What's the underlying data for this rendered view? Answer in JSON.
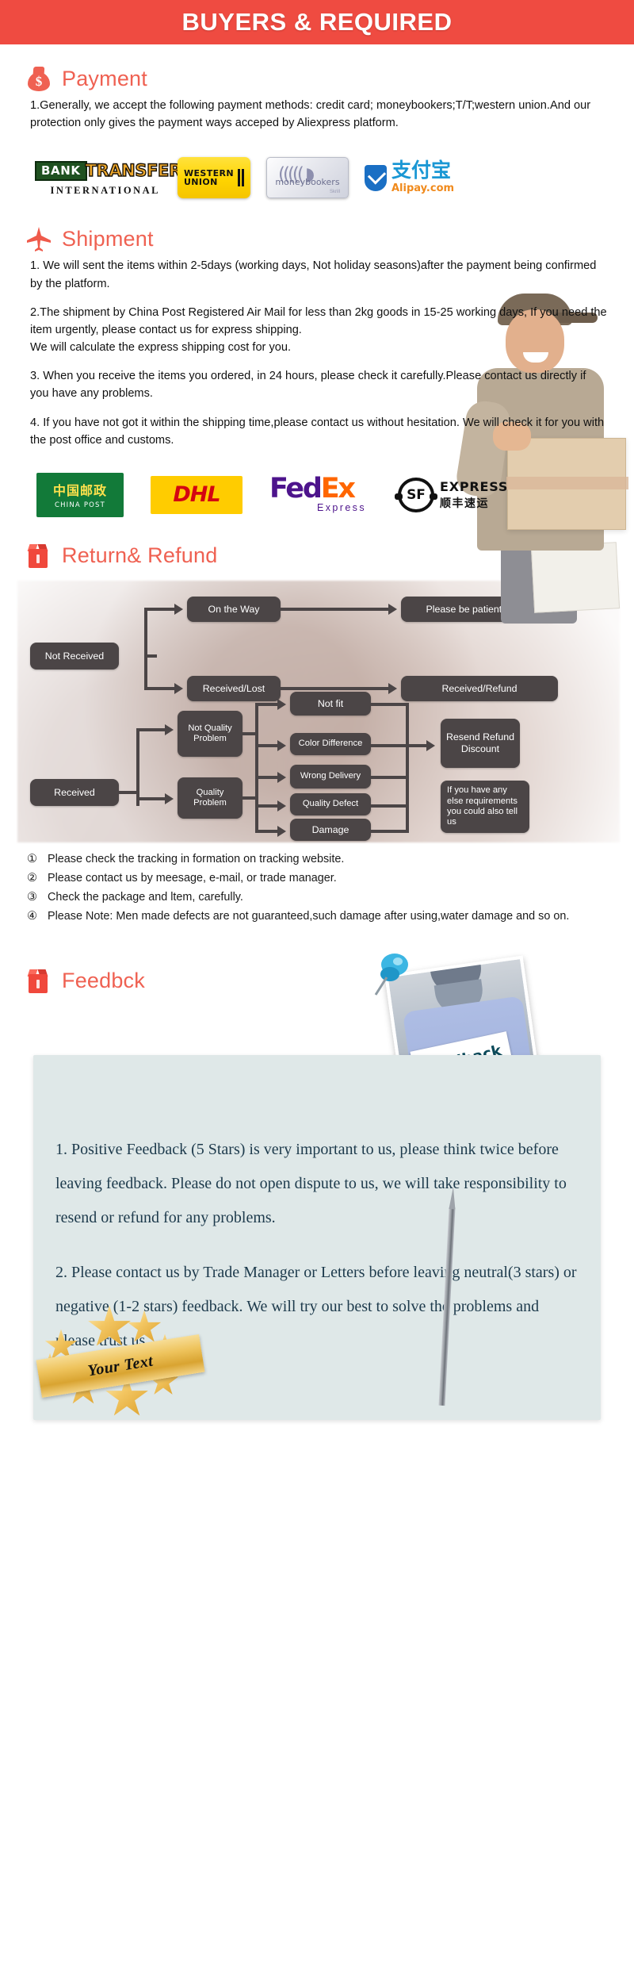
{
  "banner": {
    "title": "BUYERS & REQUIRED"
  },
  "payment": {
    "heading": "Payment",
    "icon": "money-bag-icon",
    "paragraphs": [
      "1.Generally, we accept the following payment methods: credit card; moneybookers;T/T;western union.And our protection only gives the payment ways acceped by Aliexpress platform."
    ],
    "logos": [
      {
        "name": "bank-transfer",
        "word1": "BANK",
        "word2": "TRANSFER",
        "sub": "INTERNATIONAL"
      },
      {
        "name": "western-union",
        "line1": "WESTERN",
        "line2": "UNION"
      },
      {
        "name": "moneybookers",
        "label": "moneybookers",
        "sub": "Skrill"
      },
      {
        "name": "alipay",
        "zh": "支付宝",
        "en": "Alipay.com"
      }
    ]
  },
  "shipment": {
    "heading": "Shipment",
    "icon": "airplane-icon",
    "paragraphs": [
      "1. We will sent the items within 2-5days (working days, Not holiday seasons)after the payment being confirmed by the platform.",
      "2.The shipment by China Post Registered Air Mail for less than  2kg goods in 15-25 working days, If  you need the item urgently, please contact us for express shipping.\nWe will calculate the express shipping cost for you.",
      "3. When you receive the items you ordered, in 24 hours, please check  it carefully.Please contact us directly if you have any problems.",
      "4. If you have not got it within the shipping time,please contact us without hesitation. We will check it for you with the post office and customs."
    ],
    "para2a": "2.The shipment by China Post Registered Air Mail for less than  2kg goods in 15-25 working days, If  you need the item urgently, please contact us for express shipping.",
    "para2b": "We will calculate the express shipping cost for you.",
    "carriers": [
      {
        "name": "china-post",
        "zh": "中国邮政",
        "en": "CHINA POST"
      },
      {
        "name": "dhl",
        "label": "DHL"
      },
      {
        "name": "fedex",
        "fed": "Fed",
        "ex": "Ex",
        "sub": "Express"
      },
      {
        "name": "sf-express",
        "mark": "SF",
        "line1": "EXPRESS",
        "line2": "顺丰速运"
      }
    ]
  },
  "return_refund": {
    "heading": "Return& Refund",
    "icon": "open-box-icon",
    "flow": {
      "not_received": "Not Received",
      "on_the_way": "On the Way",
      "please_wait": "Please be patient to wait",
      "received_lost": "Received/Lost",
      "received_refund": "Received/Refund",
      "received": "Received",
      "not_quality_problem": "Not Quality Problem",
      "quality_problem": "Quality Problem",
      "not_fit": "Not fit",
      "wrong_delivery": "Wrong Delivery",
      "color_difference": "Color Difference",
      "quality_defect": "Quality Defect",
      "damage": "Damage",
      "resend_refund_discount": "Resend Refund Discount",
      "callout": "If you have any else requirements you could also tell us"
    },
    "notes": [
      {
        "mark": "①",
        "text": "Please check the tracking in formation on tracking website."
      },
      {
        "mark": "②",
        "text": "Please contact us by meesage, e-mail, or trade manager."
      },
      {
        "mark": "③",
        "text": "Check the package and ltem, carefully."
      },
      {
        "mark": "④",
        "text": "Please Note: Men made defects  are not guaranteed,such damage after using,water damage and so on."
      }
    ]
  },
  "feedback": {
    "heading": "Feedbck",
    "icon": "open-box-icon",
    "photo_sign": "Feedback",
    "paragraphs": [
      "1. Positive Feedback (5 Stars) is very important to us, please think twice before leaving feedback. Please do not open dispute to us,   we will take responsibility to resend or refund for any problems.",
      "2. Please contact us by Trade Manager or Letters before leaving neutral(3 stars) or negative (1-2 stars) feedback. We will try our best to solve the problems and please trust us"
    ],
    "badge_text": "Your Text"
  },
  "colors": {
    "banner_red": "#ef4b41",
    "heading_red": "#ef6152",
    "node_gray": "#4b4546",
    "feedback_card": "#dfe8e8",
    "feedback_text": "#1d3a4c"
  }
}
